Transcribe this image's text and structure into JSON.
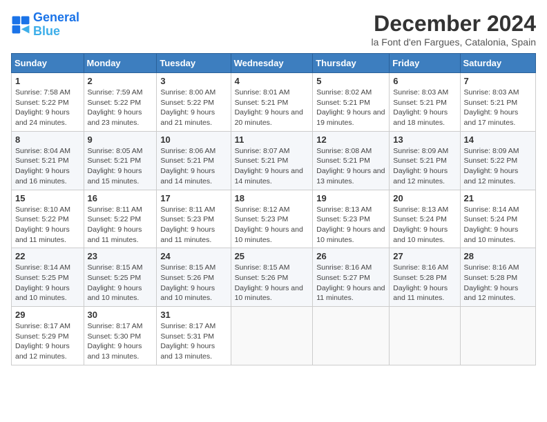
{
  "header": {
    "logo_line1": "General",
    "logo_line2": "Blue",
    "month": "December 2024",
    "location": "la Font d'en Fargues, Catalonia, Spain"
  },
  "columns": [
    "Sunday",
    "Monday",
    "Tuesday",
    "Wednesday",
    "Thursday",
    "Friday",
    "Saturday"
  ],
  "weeks": [
    [
      {
        "day": "1",
        "detail": "Sunrise: 7:58 AM\nSunset: 5:22 PM\nDaylight: 9 hours and 24 minutes."
      },
      {
        "day": "2",
        "detail": "Sunrise: 7:59 AM\nSunset: 5:22 PM\nDaylight: 9 hours and 23 minutes."
      },
      {
        "day": "3",
        "detail": "Sunrise: 8:00 AM\nSunset: 5:22 PM\nDaylight: 9 hours and 21 minutes."
      },
      {
        "day": "4",
        "detail": "Sunrise: 8:01 AM\nSunset: 5:21 PM\nDaylight: 9 hours and 20 minutes."
      },
      {
        "day": "5",
        "detail": "Sunrise: 8:02 AM\nSunset: 5:21 PM\nDaylight: 9 hours and 19 minutes."
      },
      {
        "day": "6",
        "detail": "Sunrise: 8:03 AM\nSunset: 5:21 PM\nDaylight: 9 hours and 18 minutes."
      },
      {
        "day": "7",
        "detail": "Sunrise: 8:03 AM\nSunset: 5:21 PM\nDaylight: 9 hours and 17 minutes."
      }
    ],
    [
      {
        "day": "8",
        "detail": "Sunrise: 8:04 AM\nSunset: 5:21 PM\nDaylight: 9 hours and 16 minutes."
      },
      {
        "day": "9",
        "detail": "Sunrise: 8:05 AM\nSunset: 5:21 PM\nDaylight: 9 hours and 15 minutes."
      },
      {
        "day": "10",
        "detail": "Sunrise: 8:06 AM\nSunset: 5:21 PM\nDaylight: 9 hours and 14 minutes."
      },
      {
        "day": "11",
        "detail": "Sunrise: 8:07 AM\nSunset: 5:21 PM\nDaylight: 9 hours and 14 minutes."
      },
      {
        "day": "12",
        "detail": "Sunrise: 8:08 AM\nSunset: 5:21 PM\nDaylight: 9 hours and 13 minutes."
      },
      {
        "day": "13",
        "detail": "Sunrise: 8:09 AM\nSunset: 5:21 PM\nDaylight: 9 hours and 12 minutes."
      },
      {
        "day": "14",
        "detail": "Sunrise: 8:09 AM\nSunset: 5:22 PM\nDaylight: 9 hours and 12 minutes."
      }
    ],
    [
      {
        "day": "15",
        "detail": "Sunrise: 8:10 AM\nSunset: 5:22 PM\nDaylight: 9 hours and 11 minutes."
      },
      {
        "day": "16",
        "detail": "Sunrise: 8:11 AM\nSunset: 5:22 PM\nDaylight: 9 hours and 11 minutes."
      },
      {
        "day": "17",
        "detail": "Sunrise: 8:11 AM\nSunset: 5:23 PM\nDaylight: 9 hours and 11 minutes."
      },
      {
        "day": "18",
        "detail": "Sunrise: 8:12 AM\nSunset: 5:23 PM\nDaylight: 9 hours and 10 minutes."
      },
      {
        "day": "19",
        "detail": "Sunrise: 8:13 AM\nSunset: 5:23 PM\nDaylight: 9 hours and 10 minutes."
      },
      {
        "day": "20",
        "detail": "Sunrise: 8:13 AM\nSunset: 5:24 PM\nDaylight: 9 hours and 10 minutes."
      },
      {
        "day": "21",
        "detail": "Sunrise: 8:14 AM\nSunset: 5:24 PM\nDaylight: 9 hours and 10 minutes."
      }
    ],
    [
      {
        "day": "22",
        "detail": "Sunrise: 8:14 AM\nSunset: 5:25 PM\nDaylight: 9 hours and 10 minutes."
      },
      {
        "day": "23",
        "detail": "Sunrise: 8:15 AM\nSunset: 5:25 PM\nDaylight: 9 hours and 10 minutes."
      },
      {
        "day": "24",
        "detail": "Sunrise: 8:15 AM\nSunset: 5:26 PM\nDaylight: 9 hours and 10 minutes."
      },
      {
        "day": "25",
        "detail": "Sunrise: 8:15 AM\nSunset: 5:26 PM\nDaylight: 9 hours and 10 minutes."
      },
      {
        "day": "26",
        "detail": "Sunrise: 8:16 AM\nSunset: 5:27 PM\nDaylight: 9 hours and 11 minutes."
      },
      {
        "day": "27",
        "detail": "Sunrise: 8:16 AM\nSunset: 5:28 PM\nDaylight: 9 hours and 11 minutes."
      },
      {
        "day": "28",
        "detail": "Sunrise: 8:16 AM\nSunset: 5:28 PM\nDaylight: 9 hours and 12 minutes."
      }
    ],
    [
      {
        "day": "29",
        "detail": "Sunrise: 8:17 AM\nSunset: 5:29 PM\nDaylight: 9 hours and 12 minutes."
      },
      {
        "day": "30",
        "detail": "Sunrise: 8:17 AM\nSunset: 5:30 PM\nDaylight: 9 hours and 13 minutes."
      },
      {
        "day": "31",
        "detail": "Sunrise: 8:17 AM\nSunset: 5:31 PM\nDaylight: 9 hours and 13 minutes."
      },
      null,
      null,
      null,
      null
    ]
  ]
}
